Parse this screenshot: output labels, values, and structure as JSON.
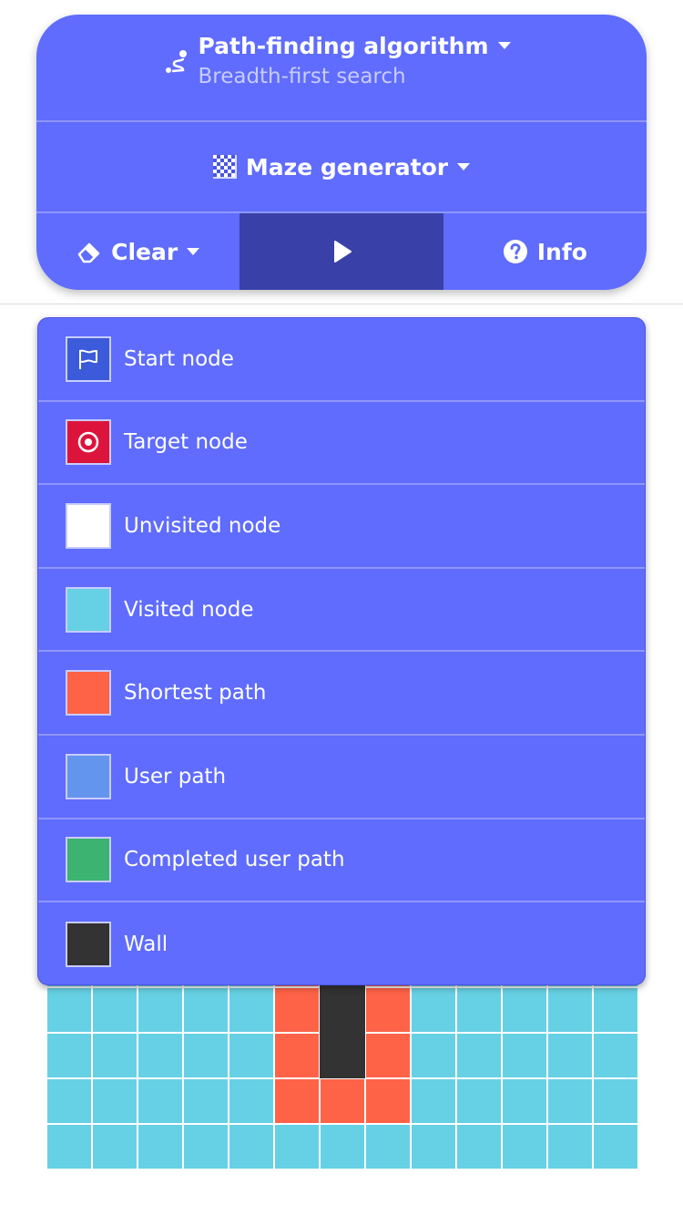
{
  "colors": {
    "panel": "#5f6cfd",
    "play_active": "#3940a8",
    "start": "#3b5bdb",
    "target": "#dc143c",
    "unvisited": "#ffffff",
    "visited": "#66d1e4",
    "shortest": "#ff6347",
    "user_path": "#6495ed",
    "completed_user_path": "#3cb371",
    "wall": "#333333"
  },
  "controls": {
    "algorithm_label": "Path-finding algorithm",
    "algorithm_value": "Breadth-first search",
    "maze_label": "Maze generator",
    "clear_label": "Clear",
    "info_label": "Info",
    "icons": {
      "algorithm": "route-icon",
      "maze": "checkerboard-icon",
      "clear": "eraser-icon",
      "play": "play-icon",
      "info": "question-circle-icon"
    }
  },
  "legend": {
    "items": [
      {
        "label": "Start node",
        "color": "#3b5bdb",
        "icon": "flag-icon"
      },
      {
        "label": "Target node",
        "color": "#dc143c",
        "icon": "target-icon"
      },
      {
        "label": "Unvisited node",
        "color": "#ffffff"
      },
      {
        "label": "Visited node",
        "color": "#66d1e4"
      },
      {
        "label": "Shortest path",
        "color": "#ff6347"
      },
      {
        "label": "User path",
        "color": "#6495ed"
      },
      {
        "label": "Completed user path",
        "color": "#3cb371"
      },
      {
        "label": "Wall",
        "color": "#333333"
      }
    ]
  },
  "grid": {
    "rows": [
      "VVVVVSWSVVVVV",
      "VVVVVSWSVVVVV",
      "VVVVVSWSVVVVV",
      "VVVVVSSSVVVVV",
      "VVVVVVVVVVVVV"
    ],
    "legend": {
      "V": "visited",
      "S": "shortest",
      "W": "wall"
    }
  }
}
